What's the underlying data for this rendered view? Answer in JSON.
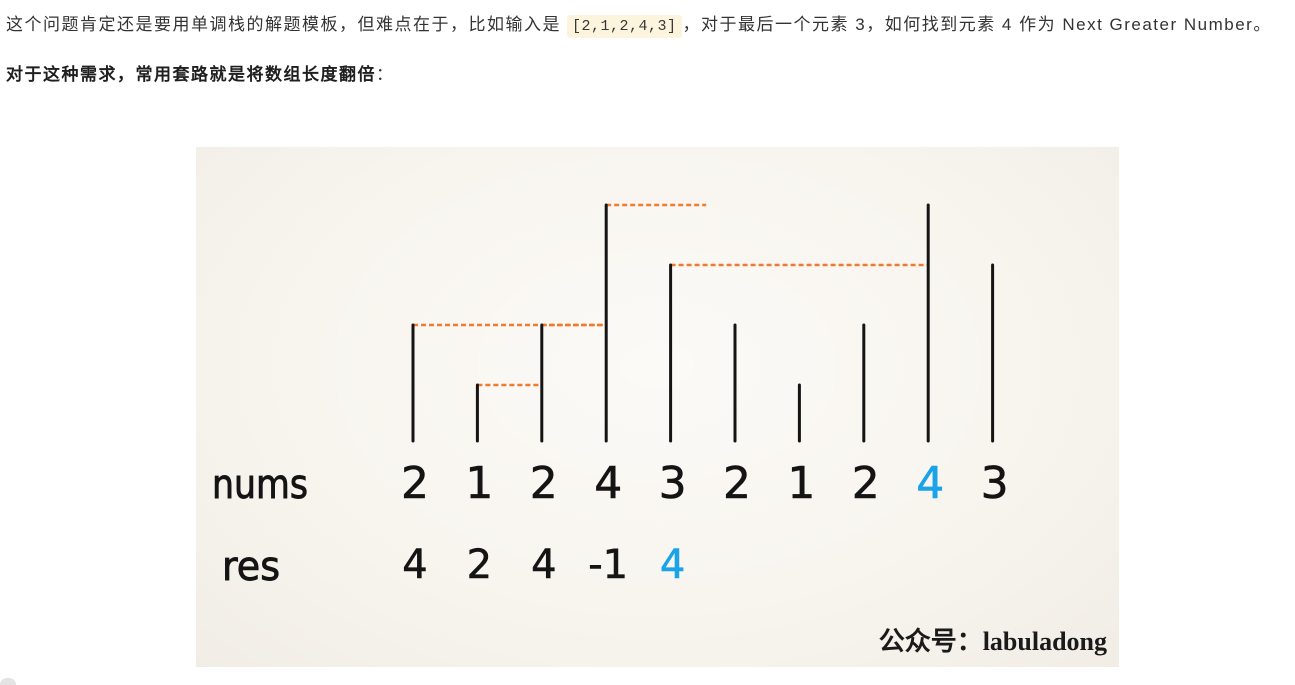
{
  "article": {
    "paragraph1": {
      "text_before": "这个问题肯定还是要用单调栈的解题模板，但难点在于，比如输入是",
      "code": "[2,1,2,4,3]",
      "text_after": "，对于最后一个元素 3，如何找到元素 4 作为 Next Greater Number。"
    },
    "paragraph2": {
      "bold_text": "对于这种需求，常用套路就是将数组长度翻倍",
      "text_after": "："
    }
  },
  "figure": {
    "nums": {
      "label": "nums",
      "values": [
        2,
        1,
        2,
        4,
        3,
        2,
        1,
        2,
        4,
        3
      ],
      "highlight_index": 8
    },
    "res": {
      "label": "res",
      "values": [
        4,
        2,
        4,
        -1,
        4
      ],
      "highlight_index": 4
    },
    "watermark": "公众号：labuladong",
    "colors": {
      "background": "#f8f5ef",
      "bar": "#141414",
      "link": "#ee7b2f",
      "highlight": "#1ba3ea",
      "text": "#141414"
    }
  }
}
